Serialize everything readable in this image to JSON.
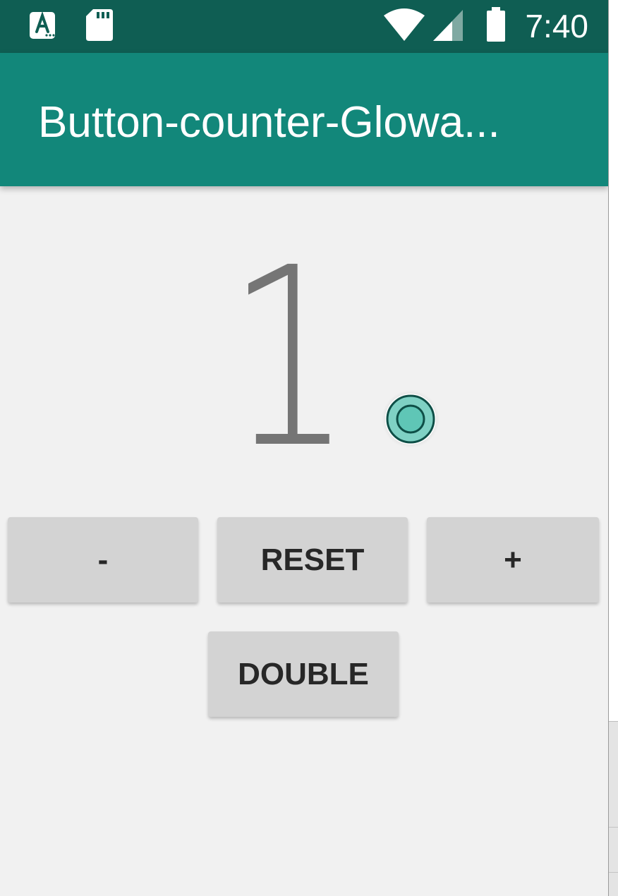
{
  "status_bar": {
    "time": "7:40",
    "left_icons": [
      "font-a-icon",
      "sd-card-icon"
    ],
    "right_icons": [
      "wifi-icon",
      "cell-signal-icon",
      "battery-icon"
    ]
  },
  "app_bar": {
    "title": "Button-counter-Glowa..."
  },
  "counter": {
    "value": "1"
  },
  "buttons": {
    "minus": "-",
    "reset": "RESET",
    "plus": "+",
    "double": "DOUBLE"
  },
  "colors": {
    "status_bar": "#0f5e53",
    "app_bar": "#12877a",
    "background": "#f1f1f1",
    "button": "#d3d3d3",
    "counter_text": "#757575"
  }
}
